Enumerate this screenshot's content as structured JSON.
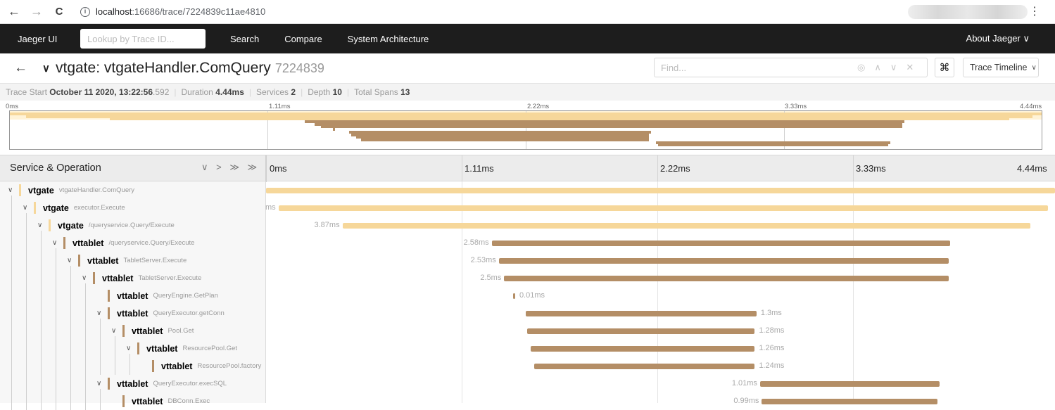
{
  "browser": {
    "back": "←",
    "forward": "→",
    "reload": "C",
    "info": "i",
    "url_host": "localhost",
    "url_path": ":16686/trace/7224839c11ae4810",
    "menu": "⋮"
  },
  "topnav": {
    "brand": "Jaeger UI",
    "lookup_placeholder": "Lookup by Trace ID...",
    "links": [
      "Search",
      "Compare",
      "System Architecture"
    ],
    "about": "About Jaeger ∨"
  },
  "trace": {
    "title": "vtgate: vtgateHandler.ComQuery",
    "trace_id_short": "7224839",
    "find_placeholder": "Find...",
    "find_icons": [
      "◎",
      "∧",
      "∨",
      "✕"
    ],
    "cmd_icon": "⌘",
    "view_selector": "Trace Timeline",
    "view_selector_caret": "∨"
  },
  "summary": {
    "start_label": "Trace Start",
    "start_value": "October 11 2020, 13:22:56",
    "start_ms": ".592",
    "duration_label": "Duration",
    "duration_value": "4.44ms",
    "services_label": "Services",
    "services_value": "2",
    "depth_label": "Depth",
    "depth_value": "10",
    "total_spans_label": "Total Spans",
    "total_spans_value": "13"
  },
  "minimap": {
    "ticks": [
      "0ms",
      "1.11ms",
      "2.22ms",
      "3.33ms",
      "4.44ms"
    ]
  },
  "timeline_header": {
    "service_operation": "Service & Operation",
    "controls": "∨ > ≫ ≫",
    "ticks": [
      "0ms",
      "1.11ms",
      "2.22ms",
      "3.33ms",
      "4.44ms"
    ]
  },
  "colors": {
    "vtgate": "#f6d79a",
    "vttablet": "#b48e66"
  },
  "spans": [
    {
      "service": "vtgate",
      "operation": "vtgateHandler.ComQuery",
      "depth": 0,
      "expandable": true,
      "start_ms": 0.0,
      "duration_ms": 4.44,
      "label": ""
    },
    {
      "service": "vtgate",
      "operation": "executor.Execute",
      "depth": 1,
      "expandable": true,
      "start_ms": 0.07,
      "duration_ms": 4.33,
      "label": "ms"
    },
    {
      "service": "vtgate",
      "operation": "/queryservice.Query/Execute",
      "depth": 2,
      "expandable": true,
      "start_ms": 0.43,
      "duration_ms": 3.87,
      "label": "3.87ms"
    },
    {
      "service": "vttablet",
      "operation": "/queryservice.Query/Execute",
      "depth": 3,
      "expandable": true,
      "start_ms": 1.27,
      "duration_ms": 2.58,
      "label": "2.58ms"
    },
    {
      "service": "vttablet",
      "operation": "TabletServer.Execute",
      "depth": 4,
      "expandable": true,
      "start_ms": 1.31,
      "duration_ms": 2.53,
      "label": "2.53ms"
    },
    {
      "service": "vttablet",
      "operation": "TabletServer.Execute",
      "depth": 5,
      "expandable": true,
      "start_ms": 1.34,
      "duration_ms": 2.5,
      "label": "2.5ms"
    },
    {
      "service": "vttablet",
      "operation": "QueryEngine.GetPlan",
      "depth": 6,
      "expandable": false,
      "start_ms": 1.39,
      "duration_ms": 0.01,
      "label": "0.01ms"
    },
    {
      "service": "vttablet",
      "operation": "QueryExecutor.getConn",
      "depth": 6,
      "expandable": true,
      "start_ms": 1.46,
      "duration_ms": 1.3,
      "label": "1.3ms"
    },
    {
      "service": "vttablet",
      "operation": "Pool.Get",
      "depth": 7,
      "expandable": true,
      "start_ms": 1.47,
      "duration_ms": 1.28,
      "label": "1.28ms"
    },
    {
      "service": "vttablet",
      "operation": "ResourcePool.Get",
      "depth": 8,
      "expandable": true,
      "start_ms": 1.49,
      "duration_ms": 1.26,
      "label": "1.26ms"
    },
    {
      "service": "vttablet",
      "operation": "ResourcePool.factory",
      "depth": 9,
      "expandable": false,
      "start_ms": 1.51,
      "duration_ms": 1.24,
      "label": "1.24ms"
    },
    {
      "service": "vttablet",
      "operation": "QueryExecutor.execSQL",
      "depth": 6,
      "expandable": true,
      "start_ms": 2.78,
      "duration_ms": 1.01,
      "label": "1.01ms"
    },
    {
      "service": "vttablet",
      "operation": "DBConn.Exec",
      "depth": 7,
      "expandable": false,
      "start_ms": 2.79,
      "duration_ms": 0.99,
      "label": "0.99ms"
    }
  ]
}
